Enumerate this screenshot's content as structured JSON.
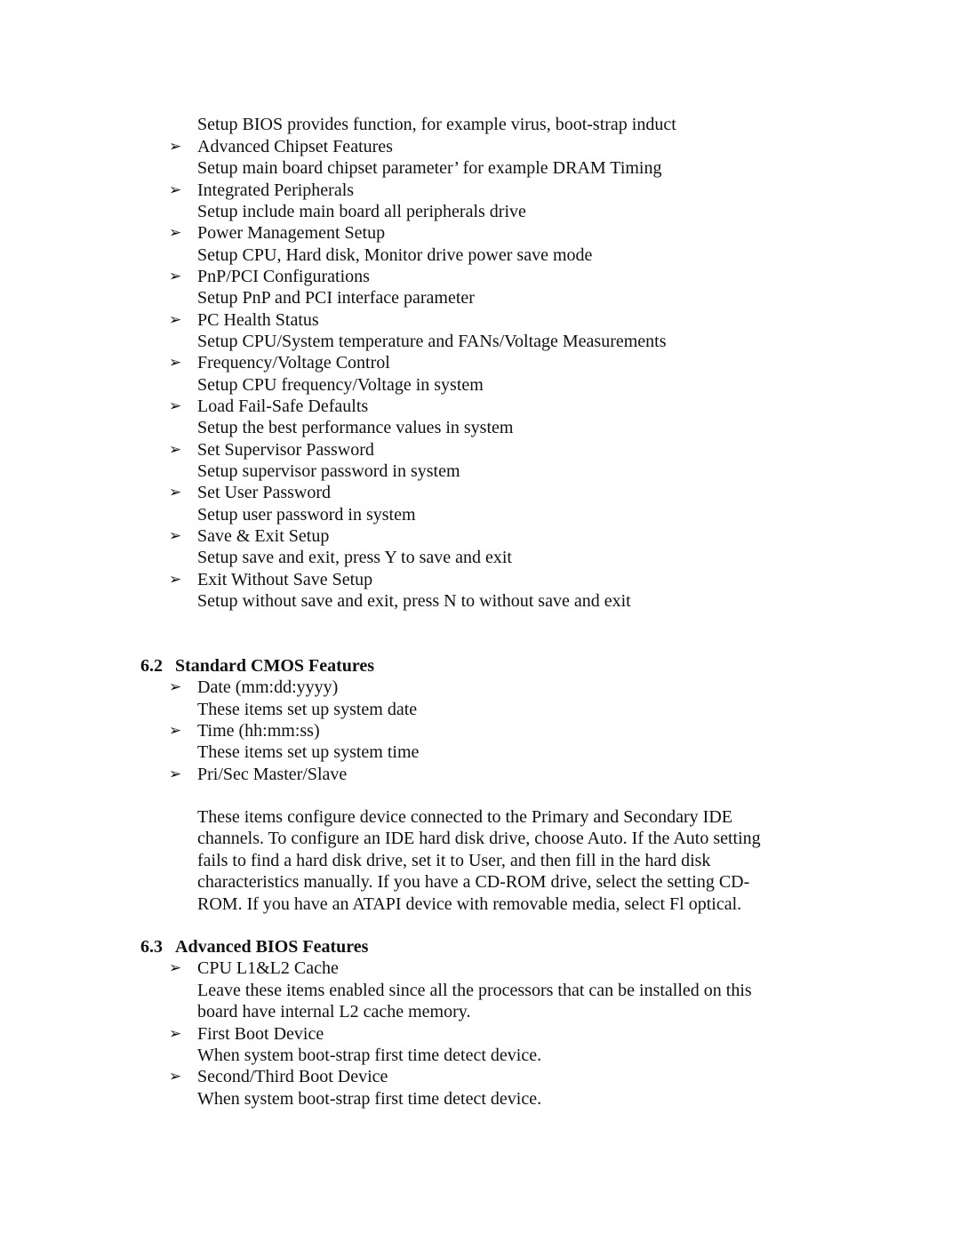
{
  "intro_description": "Setup BIOS provides function, for example virus, boot-strap induct",
  "bullet_icon": "right-arrowhead-icon",
  "menu_items": [
    {
      "title": "Advanced Chipset Features",
      "description": "Setup main board chipset parameter’ for example DRAM Timing"
    },
    {
      "title": "Integrated Peripherals",
      "description": "Setup include main board all peripherals drive"
    },
    {
      "title": "Power Management Setup",
      "description": "Setup CPU, Hard disk, Monitor drive power save mode"
    },
    {
      "title": "PnP/PCI Configurations",
      "description": "Setup PnP and PCI interface parameter"
    },
    {
      "title": "PC Health Status",
      "description": "Setup CPU/System temperature and FANs/Voltage Measurements"
    },
    {
      "title": "Frequency/Voltage Control",
      "description": "Setup CPU frequency/Voltage in system"
    },
    {
      "title": "Load Fail-Safe Defaults",
      "description": "Setup the best performance values in system"
    },
    {
      "title": "Set Supervisor Password",
      "description": "Setup supervisor password in system"
    },
    {
      "title": "Set User Password",
      "description": "Setup user password in system"
    },
    {
      "title": "Save & Exit Setup",
      "description": "Setup save and exit, press Y to save and exit"
    },
    {
      "title": "Exit Without Save Setup",
      "description": "Setup without save and exit, press N to without save and exit"
    }
  ],
  "section_62": {
    "number": "6.2",
    "title": "Standard CMOS Features",
    "items": [
      {
        "title": "Date (mm:dd:yyyy)",
        "description": "These items set up system date"
      },
      {
        "title": "Time (hh:mm:ss)",
        "description": "These items set up system time"
      },
      {
        "title": "Pri/Sec Master/Slave"
      }
    ],
    "paragraph_lines": [
      "These items configure device connected to the Primary and Secondary IDE",
      "channels. To configure an IDE hard disk drive, choose Auto. If the Auto setting",
      "fails to find a hard disk drive, set it to User, and then fill in the hard disk",
      "characteristics manually. If you have a CD-ROM drive, select the setting CD-",
      "ROM. If you have an ATAPI device with removable media, select Fl optical."
    ]
  },
  "section_63": {
    "number": "6.3",
    "title": "Advanced BIOS Features",
    "items": [
      {
        "title": "CPU L1&L2 Cache",
        "description_lines": [
          "Leave these items enabled since all the processors that can be installed on this",
          "board have internal L2 cache memory."
        ]
      },
      {
        "title": "First Boot Device",
        "description_lines": [
          "When system boot-strap first time detect device."
        ]
      },
      {
        "title": "Second/Third Boot Device",
        "description_lines": [
          "When system boot-strap first time detect device."
        ]
      }
    ]
  }
}
